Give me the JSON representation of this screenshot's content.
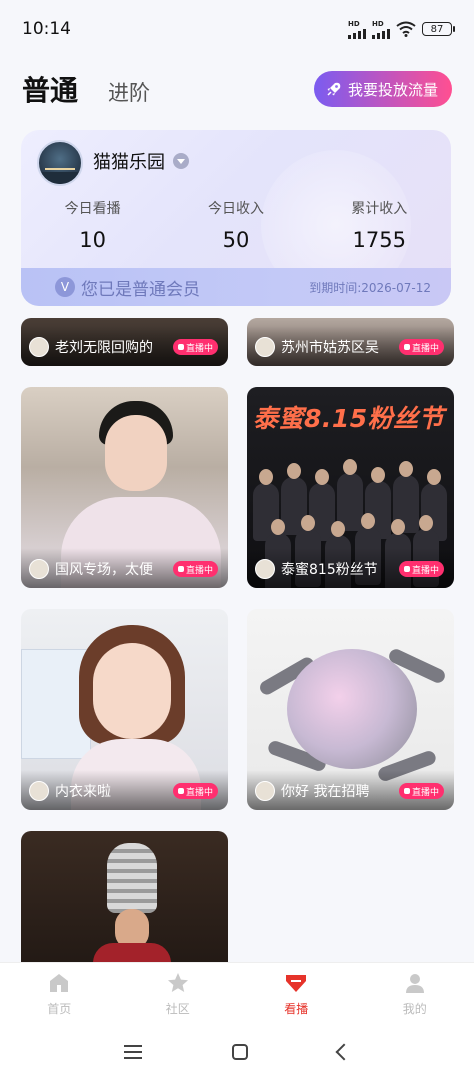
{
  "status_bar": {
    "time": "10:14",
    "signal_hd_1": "HD",
    "signal_hd_2": "HD",
    "battery": "87"
  },
  "tabs": [
    {
      "label": "普通",
      "active": true
    },
    {
      "label": "进阶",
      "active": false
    }
  ],
  "boost_button": {
    "label": "我要投放流量",
    "icon": "rocket-icon"
  },
  "member_card": {
    "name": "猫猫乐园",
    "stats": [
      {
        "label": "今日看播",
        "value": "10"
      },
      {
        "label": "今日收入",
        "value": "50"
      },
      {
        "label": "累计收入",
        "value": "1755"
      }
    ],
    "member_text": "您已是普通会员",
    "member_badge": "V",
    "expire_text": "到期时间:2026-07-12"
  },
  "live_badge": "直播中",
  "streams": [
    {
      "title": "老刘无限回购的"
    },
    {
      "title": "苏州市姑苏区吴"
    },
    {
      "title": "国风专场，太便"
    },
    {
      "title": "泰蜜815粉丝节",
      "banner": "泰蜜8.15粉丝节"
    },
    {
      "title": "内衣来啦"
    },
    {
      "title": "你好 我在招聘"
    },
    {
      "title": ""
    }
  ],
  "bottom_nav": [
    {
      "label": "首页",
      "icon": "home-icon",
      "active": false
    },
    {
      "label": "社区",
      "icon": "star-icon",
      "active": false
    },
    {
      "label": "看播",
      "icon": "watch-live-icon",
      "active": true
    },
    {
      "label": "我的",
      "icon": "profile-icon",
      "active": false
    }
  ],
  "colors": {
    "accent_red": "#e6332a",
    "live_pink": "#ff2f6f",
    "boost_gradient_start": "#7b5cf0",
    "boost_gradient_end": "#ff4f91",
    "member_text": "#6f79bb"
  }
}
